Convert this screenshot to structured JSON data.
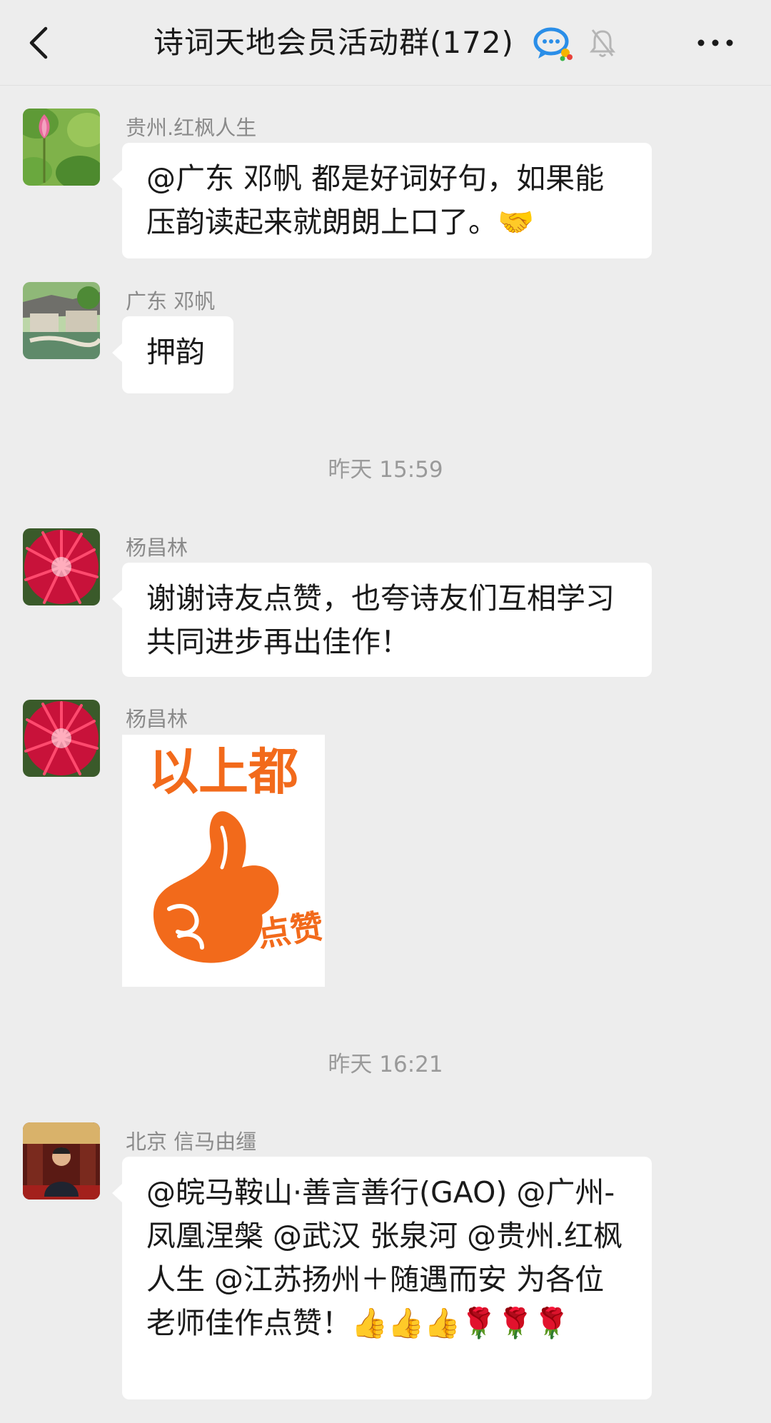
{
  "header": {
    "title": "诗词天地会员活动群(172)",
    "back_icon": "chevron-left-icon",
    "chat_icon": "group-chat-icon",
    "bell_icon": "muted-bell-icon",
    "more_icon": "more-dots-icon"
  },
  "messages": [
    {
      "sender": "贵州.红枫人生",
      "text": "@广东 邓帆  都是好词好句，如果能压韵读起来就朗朗上口了。🤝"
    },
    {
      "sender": "广东 邓帆",
      "text": "押韵"
    },
    {
      "sender": "杨昌林",
      "text": "谢谢诗友点赞，也夸诗友们互相学习共同进步再出佳作！"
    },
    {
      "sender": "杨昌林",
      "sticker_text_top": "以上都",
      "sticker_text_side": "点赞"
    },
    {
      "sender": "北京 信马由缰",
      "text": "@皖马鞍山·善言善行(GAO) @广州-凤凰涅槃  @武汉 张泉河  @贵州.红枫人生  @江苏扬州＋随遇而安  为各位老师佳作点赞！👍👍👍🌹🌹🌹"
    }
  ],
  "timestamps": [
    "昨天 15:59",
    "昨天 16:21"
  ],
  "colors": {
    "background": "#ededed",
    "bubble": "#ffffff",
    "sticker_orange": "#f26a1b"
  }
}
